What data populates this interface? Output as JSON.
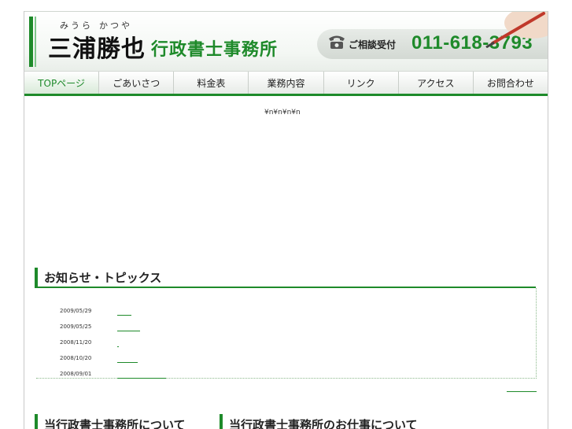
{
  "header": {
    "furigana_family": "みうら",
    "furigana_given": "かつや",
    "name": "三浦勝也",
    "office": "行政書士事務所",
    "contact_label": "ご相談受付",
    "phone": "011-618-3793"
  },
  "nav": {
    "items": [
      {
        "label": "TOPページ",
        "active": true
      },
      {
        "label": "ごあいさつ"
      },
      {
        "label": "料金表"
      },
      {
        "label": "業務内容"
      },
      {
        "label": "リンク"
      },
      {
        "label": "アクセス"
      },
      {
        "label": "お問合わせ"
      }
    ]
  },
  "main": {
    "yen_text": "¥n¥n¥n¥n",
    "news_title": "お知らせ・トピックス",
    "news": [
      {
        "date": "2009/05/29"
      },
      {
        "date": "2009/05/25"
      },
      {
        "date": "2008/11/20"
      },
      {
        "date": "2008/10/20"
      },
      {
        "date": "2008/09/01"
      }
    ],
    "about_title": "当行政書士事務所について",
    "work_title": "当行政書士事務所のお仕事について"
  },
  "colors": {
    "accent": "#1e8a2a",
    "nav_bg": "#e7ebe7"
  }
}
